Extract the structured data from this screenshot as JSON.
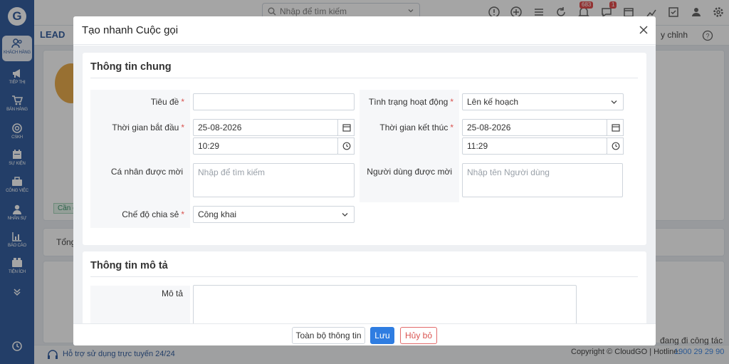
{
  "app": {
    "search_placeholder": "Nhập để tìm kiếm",
    "notification_count": "683",
    "message_count": "1",
    "breadcrumb": "LEAD",
    "adjust_label": "y chỉnh",
    "stage_tag": "Cần c",
    "tab_total": "Tổng",
    "right_snippet": "đang đi công tác"
  },
  "sidebar": {
    "items": [
      {
        "label": "KHÁCH HÀNG",
        "icon": "customers-icon"
      },
      {
        "label": "TIẾP THỊ",
        "icon": "megaphone-icon"
      },
      {
        "label": "BÁN HÀNG",
        "icon": "cart-icon"
      },
      {
        "label": "CSKH",
        "icon": "support-icon"
      },
      {
        "label": "SỰ KIỆN",
        "icon": "calendar-icon"
      },
      {
        "label": "CÔNG VIỆC",
        "icon": "briefcase-icon"
      },
      {
        "label": "NHÂN SỰ",
        "icon": "person-icon"
      },
      {
        "label": "BÁO CÁO",
        "icon": "report-icon"
      },
      {
        "label": "TIỆN ÍCH",
        "icon": "utility-icon"
      }
    ]
  },
  "modal": {
    "title": "Tạo nhanh Cuộc gọi",
    "general_section": "Thông tin chung",
    "description_section": "Thông tin mô tả",
    "fields": {
      "subject_label": "Tiêu đề",
      "subject_value": "",
      "status_label": "Tình trạng hoạt động",
      "status_value": "Lên kế hoạch",
      "start_label": "Thời gian bắt đầu",
      "start_date": "25-08-2026",
      "start_time": "10:29",
      "end_label": "Thời gian kết thúc",
      "end_date": "25-08-2026",
      "end_time": "11:29",
      "invitees_label": "Cá nhân được mời",
      "invitees_placeholder": "Nhập để tìm kiếm",
      "invited_users_label": "Người dùng được mời",
      "invited_users_placeholder": "Nhập tên Người dùng",
      "sharing_label": "Chế độ chia sẻ",
      "sharing_value": "Công khai",
      "description_label": "Mô tả",
      "description_value": ""
    },
    "buttons": {
      "full_info": "Toàn bộ thông tin",
      "save": "Lưu",
      "cancel": "Hủy bỏ"
    }
  },
  "footer": {
    "support_text": "Hỗ trợ sử dụng trực tuyến 24/24",
    "copyright": "Copyright © CloudGO | Hotline:",
    "hotline": "1900 29 29 90"
  },
  "colors": {
    "sidebar": "#1f4f96",
    "primary": "#2f7de1",
    "danger": "#d9534f"
  }
}
